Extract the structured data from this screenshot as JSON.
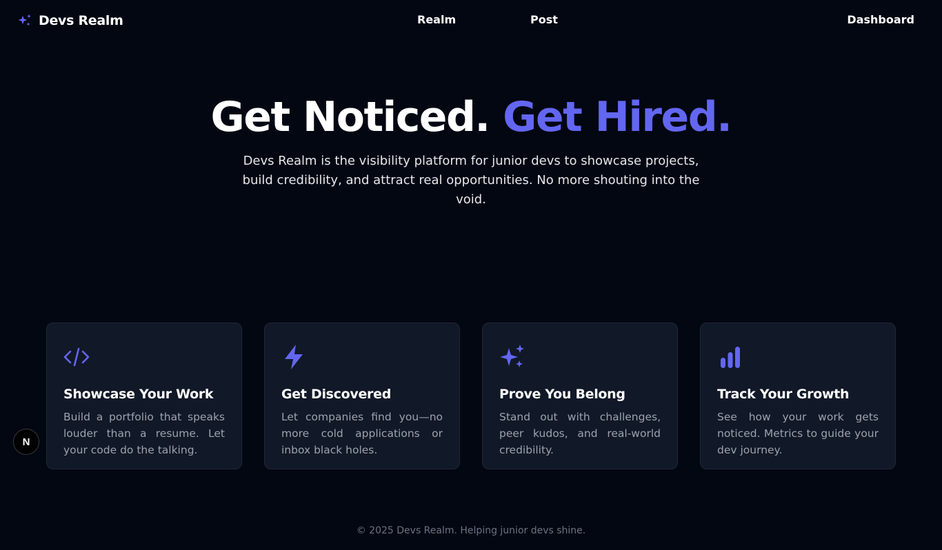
{
  "colors": {
    "background": "#030712",
    "accent": "#6366f1",
    "card": "#111827",
    "card_border": "#1f2937",
    "muted_text": "#9ca3af",
    "footer_text": "#6b7280"
  },
  "nav": {
    "brand": {
      "icon": "sparkles-icon",
      "label": "Devs Realm"
    },
    "links": [
      {
        "label": "Realm"
      },
      {
        "label": "Post"
      },
      {
        "label": "Dashboard"
      }
    ]
  },
  "hero": {
    "title_main": "Get Noticed.",
    "title_accent": "Get Hired.",
    "subtitle": "Devs Realm is the visibility platform for junior devs to showcase projects, build credibility, and attract real opportunities. No more shouting into the void."
  },
  "features": [
    {
      "icon": "code-icon",
      "title": "Showcase Your Work",
      "text": "Build a portfolio that speaks louder than a resume. Let your code do the talking."
    },
    {
      "icon": "lightning-icon",
      "title": "Get Discovered",
      "text": "Let companies find you—no more cold applications or inbox black holes."
    },
    {
      "icon": "sparkles-icon",
      "title": "Prove You Belong",
      "text": "Stand out with challenges, peer kudos, and real-world credibility."
    },
    {
      "icon": "bar-chart-icon",
      "title": "Track Your Growth",
      "text": "See how your work gets noticed. Metrics to guide your dev journey."
    }
  ],
  "dev_badge": {
    "label": "N"
  },
  "footer": {
    "text": "© 2025 Devs Realm. Helping junior devs shine."
  }
}
